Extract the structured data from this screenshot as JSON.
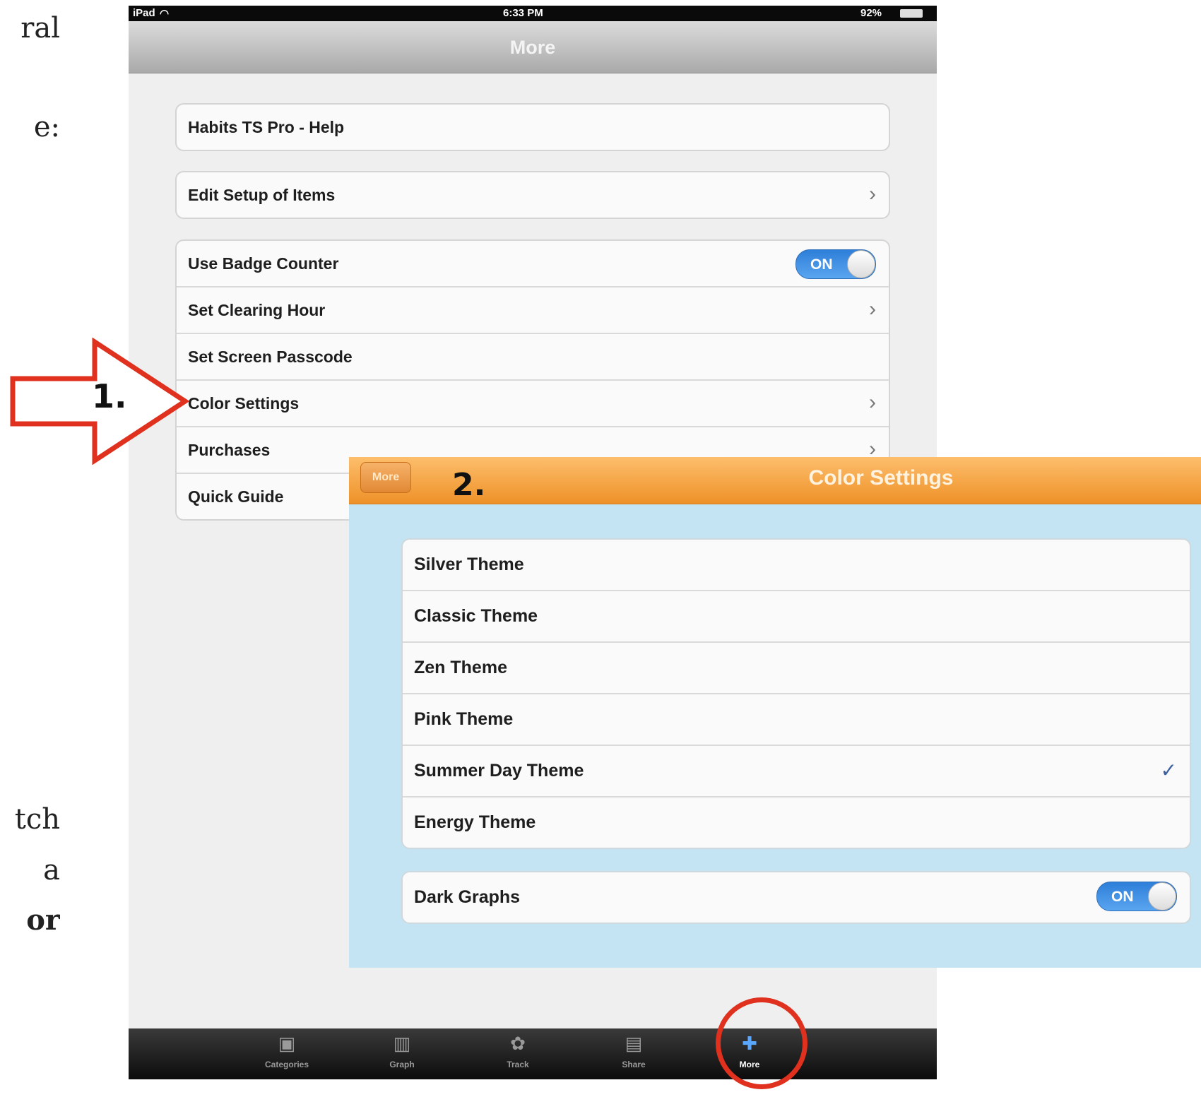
{
  "document_fragments": [
    {
      "id": "frag1",
      "text": "ral"
    },
    {
      "id": "frag2",
      "text": "e:"
    },
    {
      "id": "frag3",
      "text": "tch"
    },
    {
      "id": "frag4",
      "text": "a"
    },
    {
      "id": "frag5",
      "text": "or"
    }
  ],
  "statusbar": {
    "device": "iPad",
    "time": "6:33 PM",
    "battery": "92%"
  },
  "navbar": {
    "title": "More"
  },
  "groups": {
    "help": "Habits TS Pro - Help",
    "setup": "Edit Setup of Items",
    "settings": [
      {
        "label": "Use Badge Counter",
        "toggle": "ON"
      },
      {
        "label": "Set Clearing Hour"
      },
      {
        "label": "Set Screen Passcode"
      },
      {
        "label": "Color Settings"
      },
      {
        "label": "Purchases"
      },
      {
        "label": "Quick Guide"
      }
    ]
  },
  "tabs": [
    {
      "label": "Categories",
      "icon": "inbox-icon"
    },
    {
      "label": "Graph",
      "icon": "bar-chart-icon"
    },
    {
      "label": "Track",
      "icon": "paw-icon"
    },
    {
      "label": "Share",
      "icon": "speech-bubble-icon"
    },
    {
      "label": "More",
      "icon": "puzzle-icon",
      "active": true
    }
  ],
  "color_settings": {
    "back_label": "More",
    "title": "Color Settings",
    "themes": [
      {
        "label": "Silver Theme"
      },
      {
        "label": "Classic Theme"
      },
      {
        "label": "Zen Theme"
      },
      {
        "label": "Pink Theme"
      },
      {
        "label": "Summer Day Theme",
        "selected": true,
        "check": "✓"
      },
      {
        "label": "Energy Theme"
      }
    ],
    "dark_graphs": {
      "label": "Dark Graphs",
      "toggle": "ON"
    }
  },
  "annotations": {
    "step1": "1.",
    "step2": "2.",
    "arrow_color": "#e0301e",
    "circle_color": "#e0301e"
  }
}
